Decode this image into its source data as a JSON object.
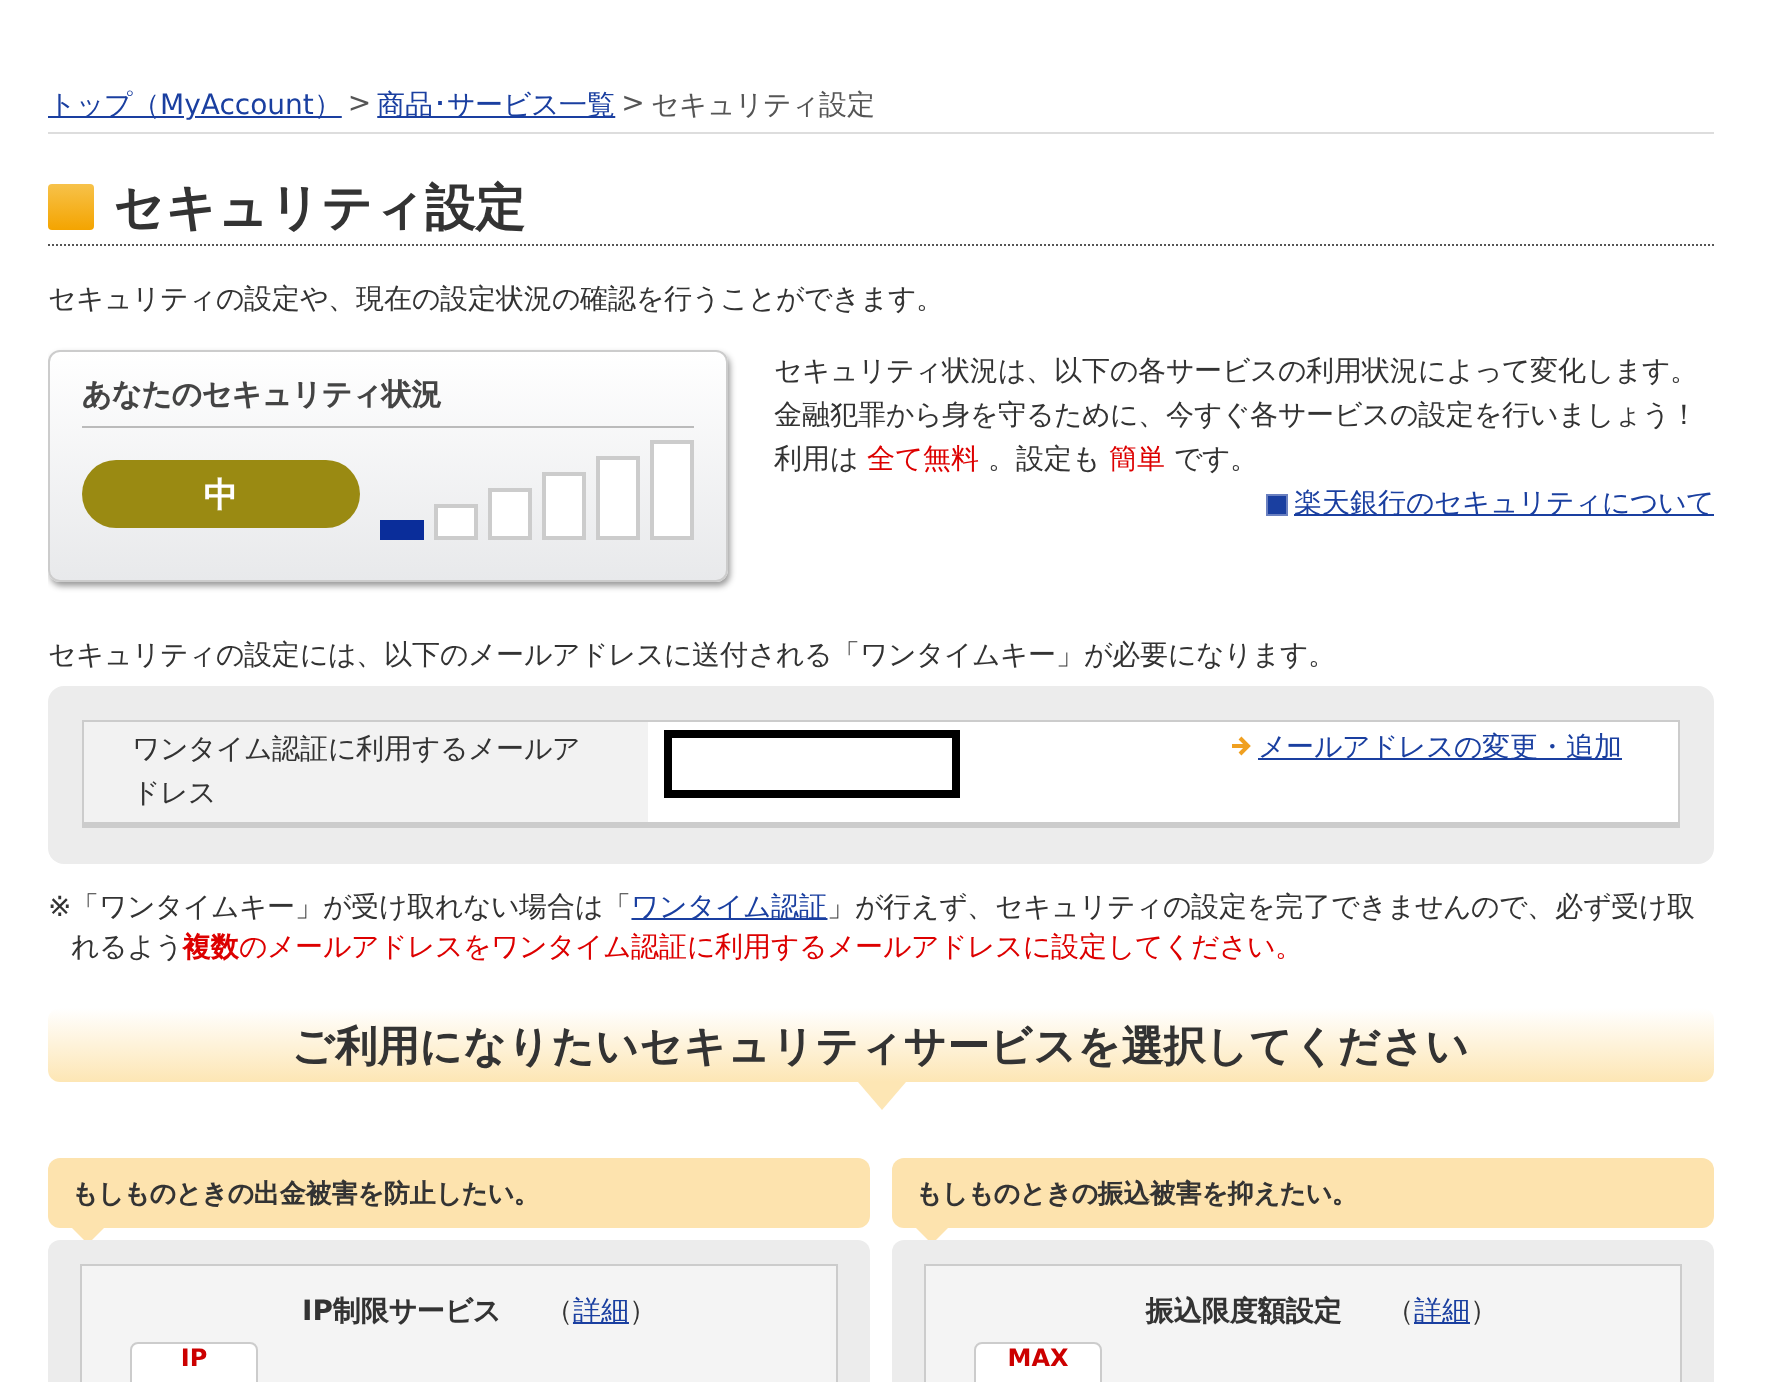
{
  "breadcrumb": {
    "links": [
      "トップ（MyAccount）",
      "商品･サービス一覧"
    ],
    "separator": ">",
    "current": "セキュリティ設定"
  },
  "page_title": "セキュリティ設定",
  "intro": "セキュリティの設定や、現在の設定状況の確認を行うことができます。",
  "status_card": {
    "title": "あなたのセキュリティ状況",
    "rating": "中",
    "meter_bars": [
      {
        "filled": true
      },
      {
        "filled": false
      },
      {
        "filled": false
      },
      {
        "filled": false
      },
      {
        "filled": false
      },
      {
        "filled": false
      }
    ]
  },
  "status_text": [
    [
      {
        "text": "セキュリティ状況は、以下の各サービスの利用状況によって変化します。",
        "emphasis": false
      }
    ],
    [
      {
        "text": "金融犯罪から身を守るために、今すぐ各サービスの設定を行いましょう！",
        "emphasis": false
      }
    ],
    [
      {
        "text": "利用は ",
        "emphasis": false
      },
      {
        "text": "全て無料",
        "emphasis": true
      },
      {
        "text": " 。設定も ",
        "emphasis": false
      },
      {
        "text": "簡単",
        "emphasis": true
      },
      {
        "text": " です。",
        "emphasis": false
      }
    ]
  ],
  "status_link": "楽天銀行のセキュリティについて",
  "email_note": "セキュリティの設定には、以下のメールアドレスに送付される「ワンタイムキー」が必要になります。",
  "email_table": {
    "label": "ワンタイム認証に利用するメールアドレス",
    "value_redacted": true,
    "link": "メールアドレスの変更・追加"
  },
  "warning": {
    "mark": "※",
    "before": "「ワンタイムキー」が受け取れない場合は「",
    "link": "ワンタイム認証",
    "after": "」が行えず、セキュリティの設定を完了できませんので、必ず受け取れるよう",
    "strong": "複数",
    "tail": "のメールアドレスをワンタイム認証に利用するメールアドレスに設定してください。"
  },
  "select_banner": "ご利用になりたいセキュリティサービスを選択してください",
  "service_groups": [
    {
      "heading": "もしものときの出金被害を防止したい。",
      "service": "IP制限サービス",
      "open_paren": "（",
      "detail_link": "詳細",
      "close_paren": "）",
      "icon_label": "IP"
    },
    {
      "heading": "もしものときの振込被害を抑えたい。",
      "service": "振込限度額設定",
      "open_paren": "（",
      "detail_link": "詳細",
      "close_paren": "）",
      "icon_label": "MAX"
    }
  ]
}
